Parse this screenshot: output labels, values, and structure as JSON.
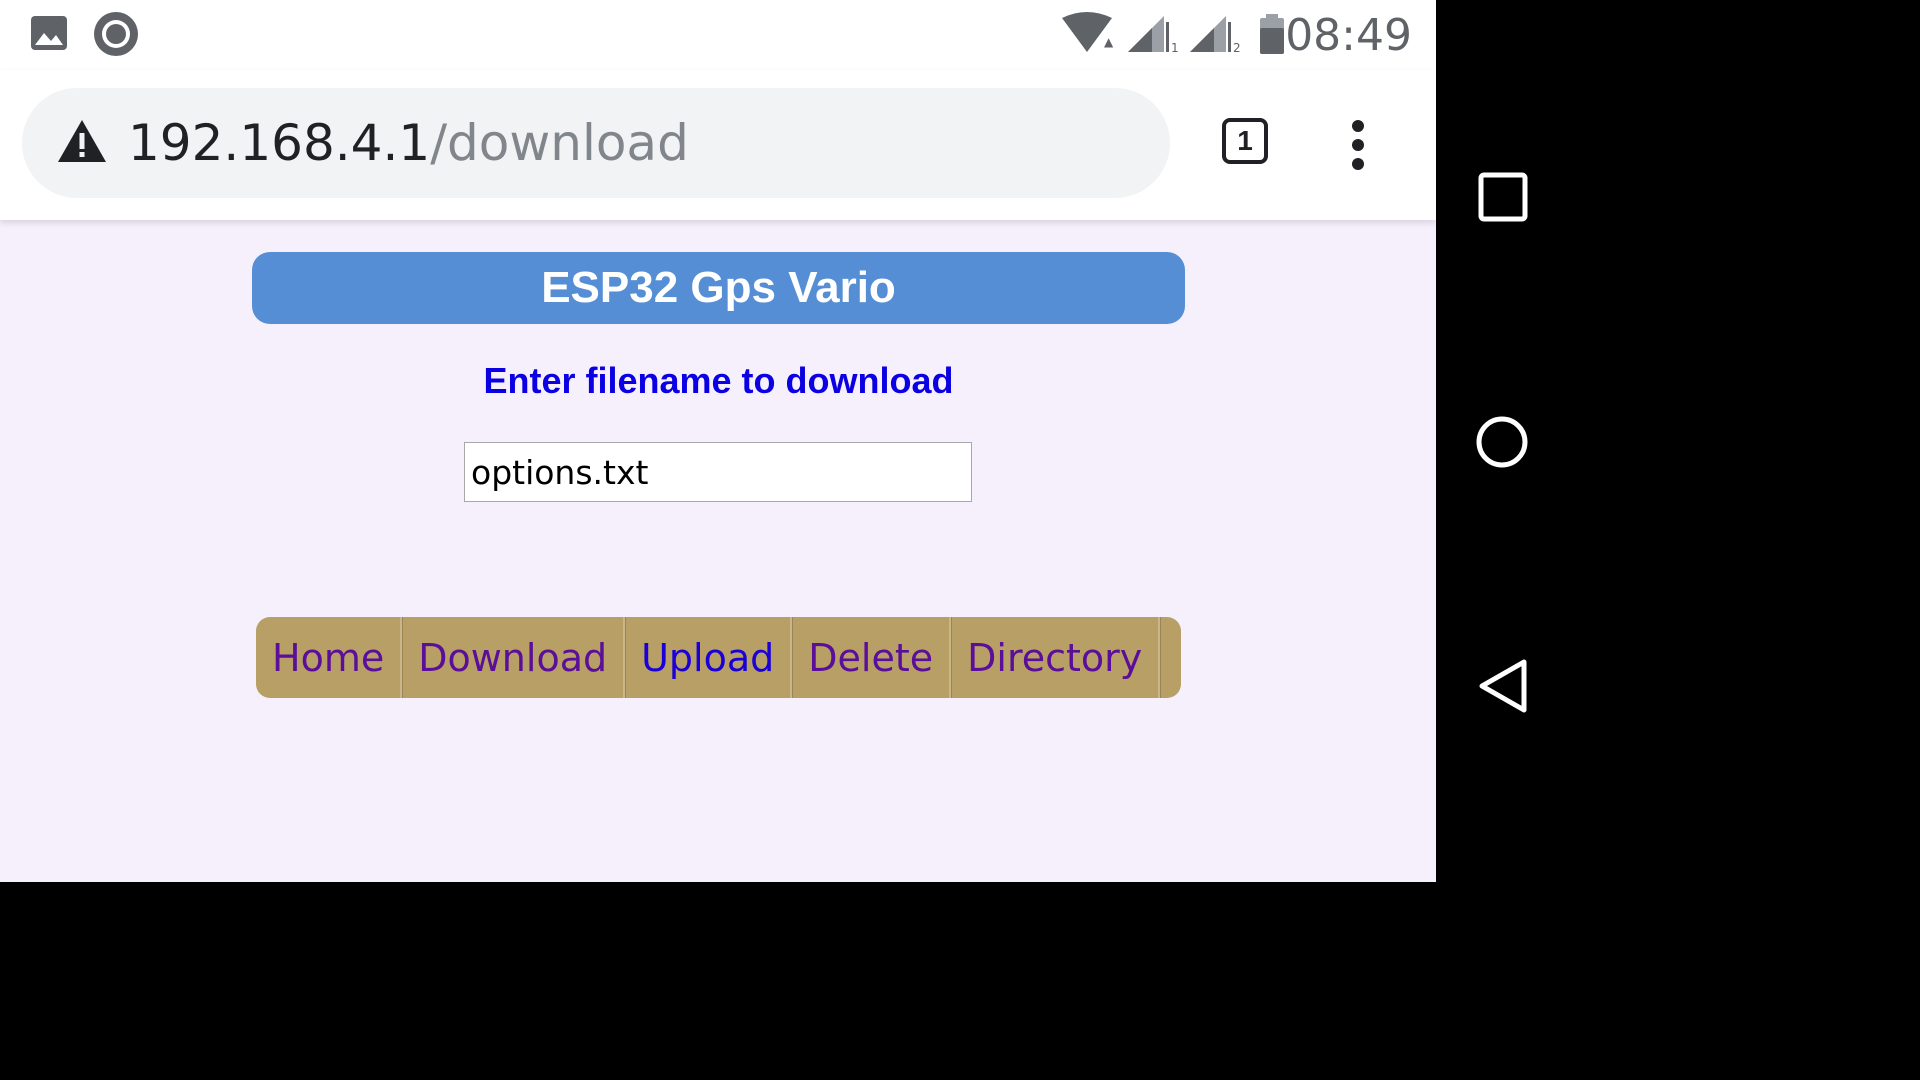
{
  "status_bar": {
    "time": "08:49",
    "icons": [
      "gallery-icon",
      "circle-app-icon",
      "wifi-icon",
      "signal-1-icon",
      "signal-2-icon",
      "battery-icon"
    ],
    "sim1_label": "1",
    "sim2_label": "2"
  },
  "browser": {
    "url_host": "192.168.4.1",
    "url_path": "/download",
    "tab_count": "1",
    "security_icon": "warning-icon"
  },
  "page": {
    "title": "ESP32 Gps Vario",
    "prompt": "Enter filename to download",
    "filename_value": "options.txt",
    "nav": [
      {
        "label": "Home"
      },
      {
        "label": "Download"
      },
      {
        "label": "Upload"
      },
      {
        "label": "Delete"
      },
      {
        "label": "Directory"
      }
    ]
  },
  "colors": {
    "title_bg": "#558ed5",
    "nav_bg": "#b89f66",
    "prompt_text": "#0b00e3",
    "page_bg": "#f6f0fc"
  },
  "android_nav": [
    "recents-icon",
    "home-icon",
    "back-icon"
  ]
}
